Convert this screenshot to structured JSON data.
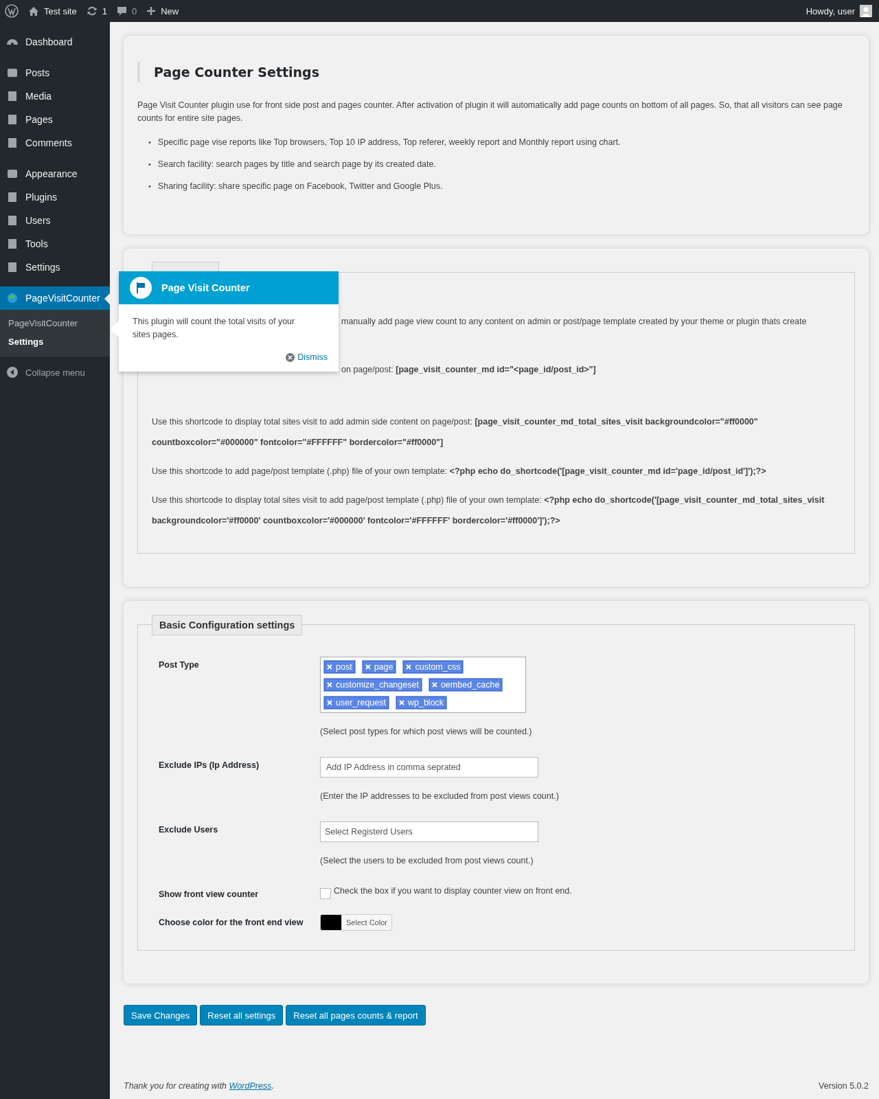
{
  "admin_bar": {
    "site": "Test site",
    "updates": "1",
    "comments": "0",
    "new": "New",
    "greeting": "Howdy, user"
  },
  "sidebar": {
    "groups": [
      [
        {
          "label": "Dashboard",
          "selected": false
        }
      ],
      [
        {
          "label": "Posts",
          "selected": false
        },
        {
          "label": "Media",
          "selected": false
        },
        {
          "label": "Pages",
          "selected": false
        },
        {
          "label": "Comments",
          "selected": false
        }
      ],
      [
        {
          "label": "Appearance",
          "selected": false
        },
        {
          "label": "Plugins",
          "selected": false
        },
        {
          "label": "Users",
          "selected": false
        },
        {
          "label": "Tools",
          "selected": false
        },
        {
          "label": "Settings",
          "selected": false
        }
      ],
      [
        {
          "label": "PageVisitCounter",
          "selected": true
        }
      ]
    ],
    "submenu": [
      {
        "label": "PageVisitCounter",
        "selected": false
      },
      {
        "label": "Settings",
        "selected": true
      }
    ],
    "collapse": "Collapse menu"
  },
  "intro": {
    "bullet": "•",
    "title": "Page Counter Settings",
    "description": "Page Visit Counter plugin use for front side post and pages counter. After activation of plugin it will automatically add page counts on bottom of all pages. So, that all visitors can see page counts for entire site pages.",
    "features": [
      "Specific page vise reports like Top browsers, Top 10 IP address, Top referer, weekly report and Monthly report using chart.",
      "Search facility: search pages by title and search page by its created date.",
      "Sharing facility: share specific page on Facebook, Twitter and Google Plus."
    ]
  },
  "shortcode": {
    "partial_lines": [
      "manually add page view count to any content on admin or post/page template created by your theme or plugin thats create",
      "on page/post: **[page_visit_counter_md id=\"<page_id/post_id>\"]**"
    ],
    "paragraphs": [
      "Use this shortcode to display total sites visit to add admin side content on page/post: **[page_visit_counter_md_total_sites_visit backgroundcolor=\"#ff0000\" countboxcolor=\"#000000\" fontcolor=\"#FFFFFF\" bordercolor=\"#ff0000\"]**",
      "Use this shortcode to add page/post template (.php) file of your own template: **<?php echo do_shortcode('[page_visit_counter_md id='page_id/post_id']');?>**",
      "Use this shortcode to display total sites visit to add page/post template (.php) file of your own template: **<?php echo do_shortcode('[page_visit_counter_md_total_sites_visit backgroundcolor='#ff0000' countboxcolor='#000000' fontcolor='#FFFFFF' bordercolor='#ff0000']');?>**"
    ]
  },
  "pointer": {
    "title": "Page Visit Counter",
    "body": "This plugin will count the total visits of your sites pages.",
    "dismiss": "Dismiss"
  },
  "config": {
    "legend": "Basic Configuration settings",
    "post_type": {
      "label": "Post Type",
      "tags": [
        "post",
        "page",
        "custom_css",
        "customize_changeset",
        "oembed_cache",
        "user_request",
        "wp_block"
      ],
      "hint": "(Select post types for which post views will be counted.)"
    },
    "exclude_ips": {
      "label": "Exclude IPs (Ip Address)",
      "placeholder": "Add IP Address in comma seprated",
      "hint": "(Enter the IP addresses to be excluded from post views count.)"
    },
    "exclude_users": {
      "label": "Exclude Users",
      "placeholder": "Select Registerd Users",
      "hint": "(Select the users to be excluded from post views count.)"
    },
    "front_counter": {
      "label": "Show front view counter",
      "checked": false,
      "text": "Check the box if you want to display counter view on front end."
    },
    "front_color": {
      "label": "Choose color for the front end view",
      "color": "#000000",
      "button": "Select Color"
    }
  },
  "buttons": [
    "Save Changes",
    "Reset all settings",
    "Reset all pages counts & report"
  ],
  "footer": {
    "thanks": "Thank you for creating with ",
    "link": "WordPress",
    "after": ".",
    "version": "Version 5.0.2"
  }
}
